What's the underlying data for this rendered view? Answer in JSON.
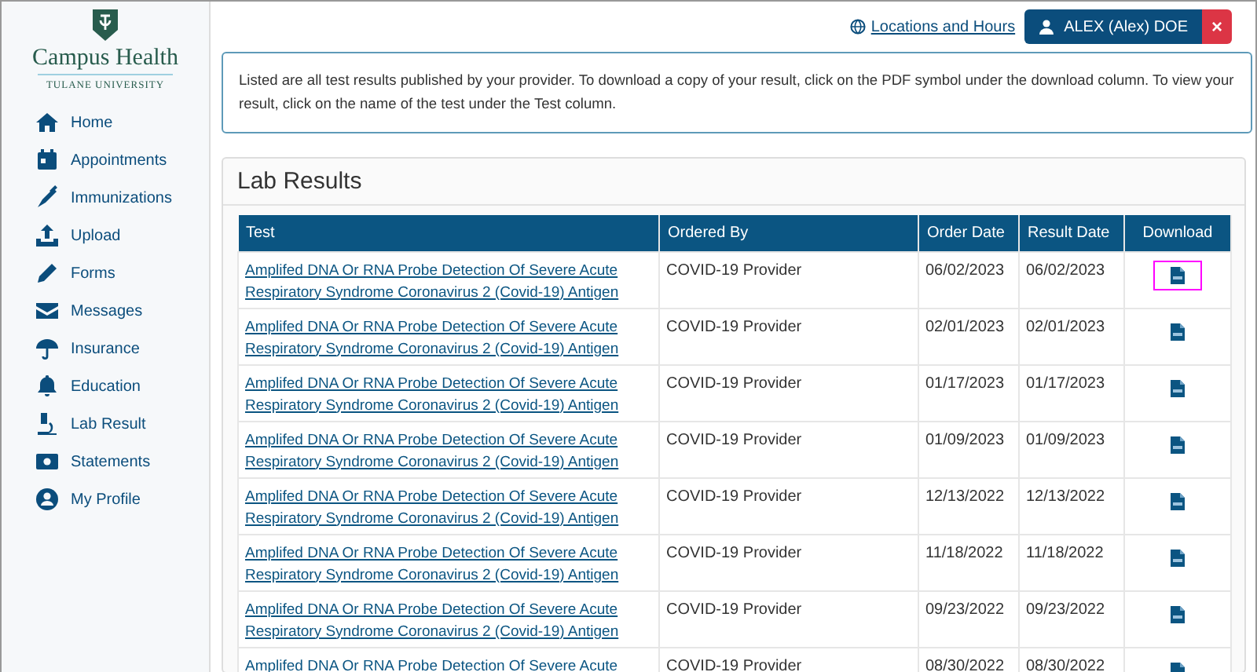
{
  "brand": {
    "title": "Campus Health",
    "subtitle": "TULANE UNIVERSITY"
  },
  "sidebar": {
    "items": [
      {
        "label": "Home",
        "selected": false
      },
      {
        "label": "Appointments",
        "selected": false
      },
      {
        "label": "Immunizations",
        "selected": false
      },
      {
        "label": "Upload",
        "selected": false
      },
      {
        "label": "Forms",
        "selected": false
      },
      {
        "label": "Messages",
        "selected": false
      },
      {
        "label": "Insurance",
        "selected": false
      },
      {
        "label": "Education",
        "selected": false
      },
      {
        "label": "Lab Result",
        "selected": false
      },
      {
        "label": "Statements",
        "selected": false
      },
      {
        "label": "My Profile",
        "selected": false
      }
    ]
  },
  "header": {
    "locations_link": "Locations and Hours",
    "user": "ALEX (Alex) DOE",
    "close": "×"
  },
  "info": "Listed are all test results published by your provider. To download a copy of your result, click on the PDF symbol under the download column. To view your result, click on the name of the test under the Test column.",
  "panel": {
    "title": "Lab Results"
  },
  "table": {
    "columns": [
      "Test",
      "Ordered By",
      "Order Date",
      "Result Date",
      "Download"
    ],
    "rows": [
      {
        "test": "Amplifed DNA Or RNA Probe Detection Of Severe Acute Respiratory Syndrome Coronavirus 2 (Covid-19) Antigen",
        "ordered_by": "COVID-19 Provider",
        "order_date": "06/02/2023",
        "result_date": "06/02/2023",
        "highlighted": true
      },
      {
        "test": "Amplifed DNA Or RNA Probe Detection Of Severe Acute Respiratory Syndrome Coronavirus 2 (Covid-19) Antigen",
        "ordered_by": "COVID-19 Provider",
        "order_date": "02/01/2023",
        "result_date": "02/01/2023",
        "highlighted": false
      },
      {
        "test": "Amplifed DNA Or RNA Probe Detection Of Severe Acute Respiratory Syndrome Coronavirus 2 (Covid-19) Antigen",
        "ordered_by": "COVID-19 Provider",
        "order_date": "01/17/2023",
        "result_date": "01/17/2023",
        "highlighted": false
      },
      {
        "test": "Amplifed DNA Or RNA Probe Detection Of Severe Acute Respiratory Syndrome Coronavirus 2 (Covid-19) Antigen",
        "ordered_by": "COVID-19 Provider",
        "order_date": "01/09/2023",
        "result_date": "01/09/2023",
        "highlighted": false
      },
      {
        "test": "Amplifed DNA Or RNA Probe Detection Of Severe Acute Respiratory Syndrome Coronavirus 2 (Covid-19) Antigen",
        "ordered_by": "COVID-19 Provider",
        "order_date": "12/13/2022",
        "result_date": "12/13/2022",
        "highlighted": false
      },
      {
        "test": "Amplifed DNA Or RNA Probe Detection Of Severe Acute Respiratory Syndrome Coronavirus 2 (Covid-19) Antigen",
        "ordered_by": "COVID-19 Provider",
        "order_date": "11/18/2022",
        "result_date": "11/18/2022",
        "highlighted": false
      },
      {
        "test": "Amplifed DNA Or RNA Probe Detection Of Severe Acute Respiratory Syndrome Coronavirus 2 (Covid-19) Antigen",
        "ordered_by": "COVID-19 Provider",
        "order_date": "09/23/2022",
        "result_date": "09/23/2022",
        "highlighted": false
      },
      {
        "test": "Amplifed DNA Or RNA Probe Detection Of Severe Acute",
        "ordered_by": "COVID-19 Provider",
        "order_date": "08/30/2022",
        "result_date": "08/30/2022",
        "highlighted": false
      }
    ]
  }
}
